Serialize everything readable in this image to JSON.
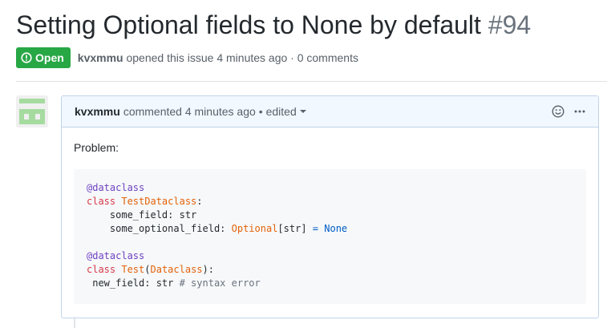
{
  "issue": {
    "title": "Setting Optional fields to None by default",
    "number": "#94",
    "state": "Open",
    "author": "kvxmmu",
    "opened_text": "opened this issue 4 minutes ago · 0 comments"
  },
  "comment": {
    "author": "kvxmmu",
    "action_text": "commented 4 minutes ago",
    "edited_text": "• edited",
    "body_text": "Problem:",
    "code": {
      "l1_decorator": "@dataclass",
      "l2_kw": "class",
      "l2_name": "TestDataclass",
      "l2_colon": ":",
      "l3": "    some_field: str",
      "l4_pre": "    some_optional_field: ",
      "l4_type": "Optional",
      "l4_mid": "[str] ",
      "l4_eq": "=",
      "l4_none": "None",
      "l6_decorator": "@dataclass",
      "l7_kw": "class",
      "l7_name": "Test",
      "l7_paren_open": "(",
      "l7_base": "Dataclass",
      "l7_paren_close": "):",
      "l8_pre": " new_field: str ",
      "l8_comment": "# syntax error"
    }
  },
  "colors": {
    "open_badge": "#28a745",
    "comment_header_bg": "#f1f8ff",
    "comment_border": "#c0d3eb"
  }
}
